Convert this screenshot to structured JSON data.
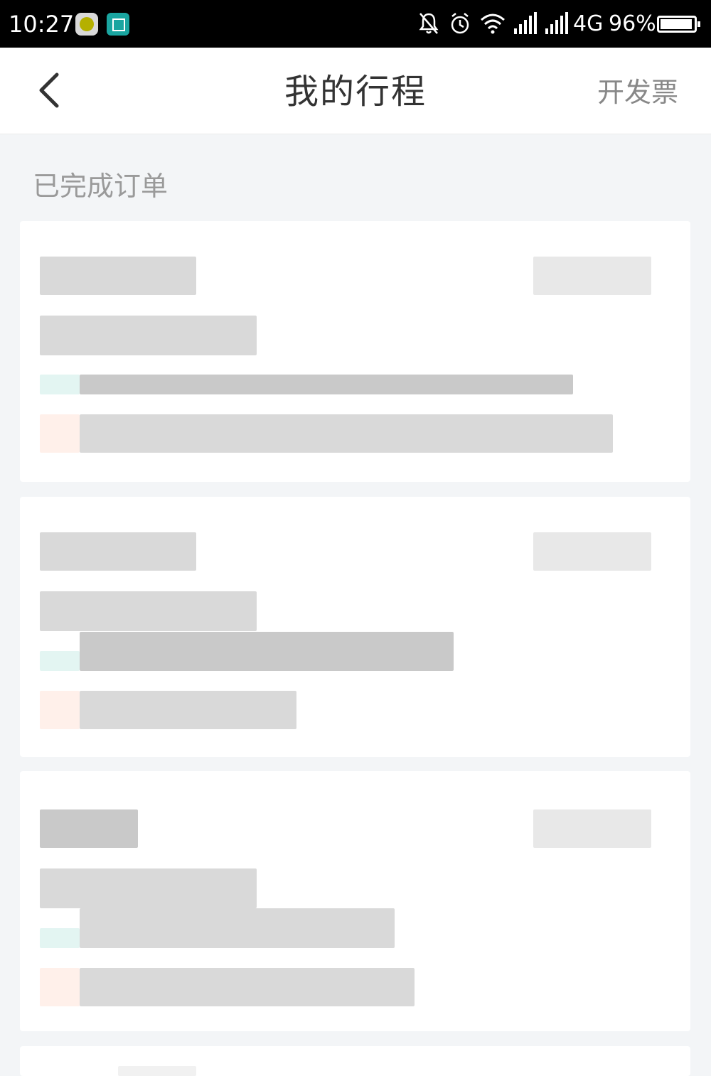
{
  "status_bar": {
    "time": "10:27",
    "network": "4G",
    "battery_text": "96%",
    "battery_level": 0.96
  },
  "nav": {
    "title": "我的行程",
    "action": "开发票",
    "back_icon": "chevron-left-icon"
  },
  "section": {
    "title": "已完成订单"
  },
  "colors": {
    "background": "#f3f5f7",
    "nav_title": "#333333",
    "muted": "#9a9a9a",
    "start_dot": "#e3f5f2",
    "end_dot": "#fff0ea"
  }
}
